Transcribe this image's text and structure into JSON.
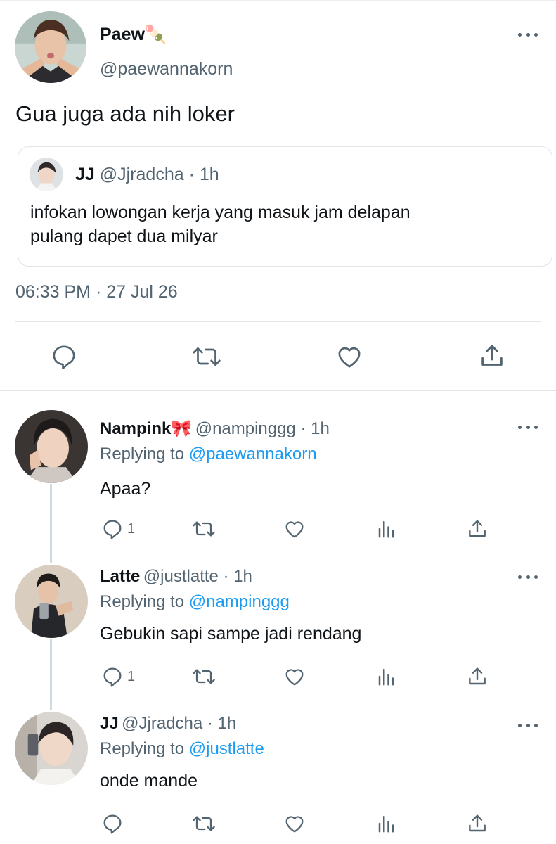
{
  "main_tweet": {
    "name": "Paew🍡",
    "handle": "@paewannakorn",
    "text": "Gua juga ada nih loker",
    "quote": {
      "name": "JJ",
      "handle": "@Jjradcha",
      "time": "· 1h",
      "line1": "infokan lowongan kerja yang masuk jam delapan",
      "line2": "pulang dapet dua milyar"
    },
    "timestamp": "06:33 PM · 27 Jul 26"
  },
  "replies": [
    {
      "name": "Nampink🎀",
      "handle": "@nampinggg · 1h",
      "replying_prefix": "Replying to",
      "replying_to": "@paewannakorn",
      "text": "Apaa?",
      "reply_count": "1"
    },
    {
      "name": "Latte",
      "handle": "@justlatte · 1h",
      "replying_prefix": "Replying to",
      "replying_to": "@nampinggg",
      "text": "Gebukin sapi sampe jadi rendang",
      "reply_count": "1"
    },
    {
      "name": "JJ",
      "handle": "@Jjradcha · 1h",
      "replying_prefix": "Replying to",
      "replying_to": "@justlatte",
      "text": "onde mande",
      "reply_count": ""
    }
  ],
  "colors": {
    "text": "#0f1419",
    "secondary": "#536471",
    "link": "#1d9bf0",
    "divider": "#e1e5e8"
  },
  "icons": [
    "more-icon",
    "reply-icon",
    "retweet-icon",
    "like-icon",
    "share-icon",
    "analytics-icon"
  ]
}
